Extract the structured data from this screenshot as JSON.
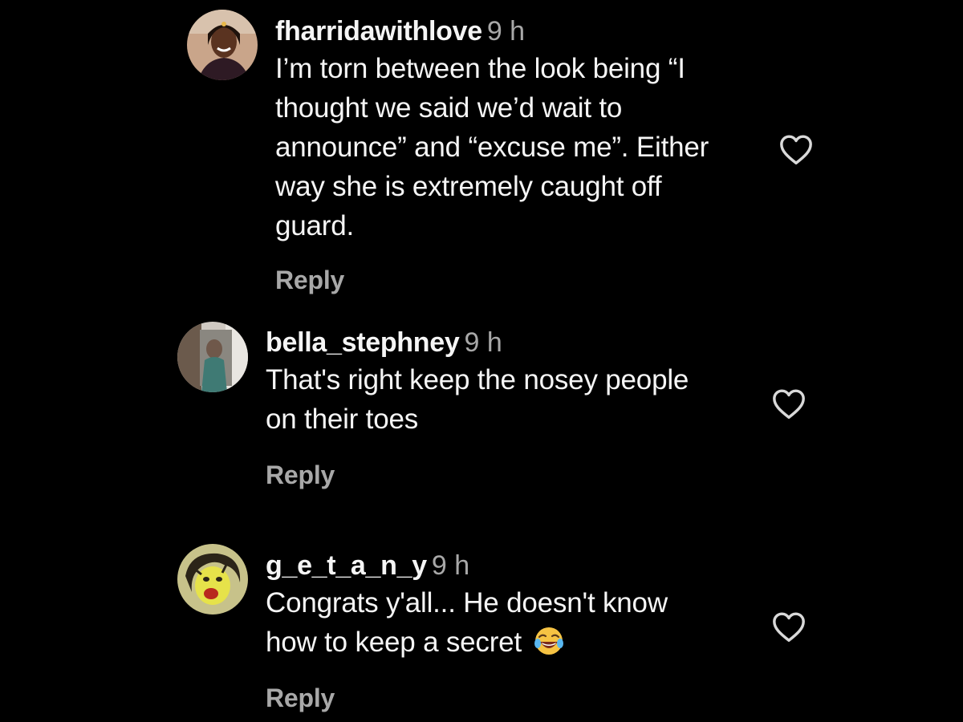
{
  "comments": [
    {
      "username": "fharridawithlove",
      "time": "9 h",
      "text_lines": [
        "I’m torn between the look being “I",
        "thought we said we’d wait to",
        "announce” and “excuse me”. Either",
        "way she is extremely caught off",
        "guard."
      ],
      "reply_label": "Reply",
      "like_icon": "heart-outline-icon"
    },
    {
      "username": "bella_stephney",
      "time": "9 h",
      "text_lines": [
        "That's right keep the nosey people",
        "on their toes"
      ],
      "reply_label": "Reply",
      "like_icon": "heart-outline-icon"
    },
    {
      "username": "g_e_t_a_n_y",
      "time": "9 h",
      "text_lines": [
        "Congrats y'all... He doesn't know",
        "how to keep a secret"
      ],
      "emoji": "rolling-on-floor-laughing-emoji",
      "reply_label": "Reply",
      "like_icon": "heart-outline-icon"
    }
  ],
  "colors": {
    "background": "#000000",
    "primary_text": "#f5f5f5",
    "secondary_text": "#a8a8a8"
  }
}
